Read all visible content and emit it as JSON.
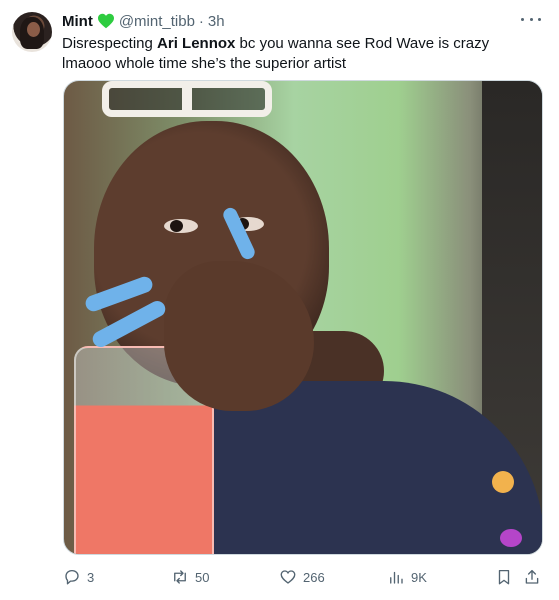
{
  "tweet": {
    "author_name": "Mint",
    "author_handle": "@mint_tibb",
    "separator": "·",
    "time": "3h",
    "text_before": "Disrespecting ",
    "text_bold": "Ari Lennox",
    "text_after": " bc you wanna see Rod Wave is crazy lmaooo whole time she’s the superior artist"
  },
  "icons": {
    "verified": "green-heart-icon",
    "more": "more-icon",
    "reply": "reply-icon",
    "retweet": "retweet-icon",
    "like": "like-icon",
    "views": "views-icon",
    "bookmark": "bookmark-icon",
    "share": "share-icon"
  },
  "stats": {
    "replies": "3",
    "retweets": "50",
    "likes": "266",
    "views": "9K"
  },
  "colors": {
    "heart": "#2ecc40",
    "muted": "#536471",
    "text": "#0f1419"
  }
}
